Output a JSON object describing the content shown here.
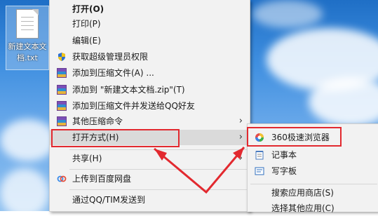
{
  "desktop_file": {
    "label": "新建文本文档.txt"
  },
  "context_menu": {
    "items": [
      {
        "label": "打开(O)",
        "bold": true
      },
      {
        "label": "打印(P)"
      },
      {
        "label": "编辑(E)"
      },
      {
        "label": "获取超级管理员权限",
        "icon": "shield-icon"
      },
      {
        "label": "添加到压缩文件(A) ...",
        "icon": "winrar-icon"
      },
      {
        "label": "添加到 \"新建文本文档.zip\"(T)",
        "icon": "winrar-icon"
      },
      {
        "label": "添加到压缩文件并发送给QQ好友",
        "icon": "winrar-icon"
      },
      {
        "label": "其他压缩命令",
        "icon": "winrar-icon",
        "submenu": true
      },
      {
        "label": "打开方式(H)",
        "submenu": true,
        "highlighted": true
      },
      {
        "label": "共享(H)",
        "submenu": true
      },
      {
        "label": "上传到百度网盘",
        "icon": "baidu-cloud-icon"
      },
      {
        "label": "通过QQ/TIM发送到"
      }
    ]
  },
  "open_with_menu": {
    "items": [
      {
        "label": "360极速浏览器",
        "icon": "360-browser-icon"
      },
      {
        "label": "记事本",
        "icon": "notepad-icon"
      },
      {
        "label": "写字板",
        "icon": "wordpad-icon"
      },
      {
        "label": "搜索应用商店(S)"
      },
      {
        "label": "选择其他应用(C)"
      }
    ]
  },
  "submenu_arrow": "›",
  "colors": {
    "annotation_red": "#e2292f",
    "menu_bg": "#f2f2f2",
    "highlight": "#dadada"
  }
}
